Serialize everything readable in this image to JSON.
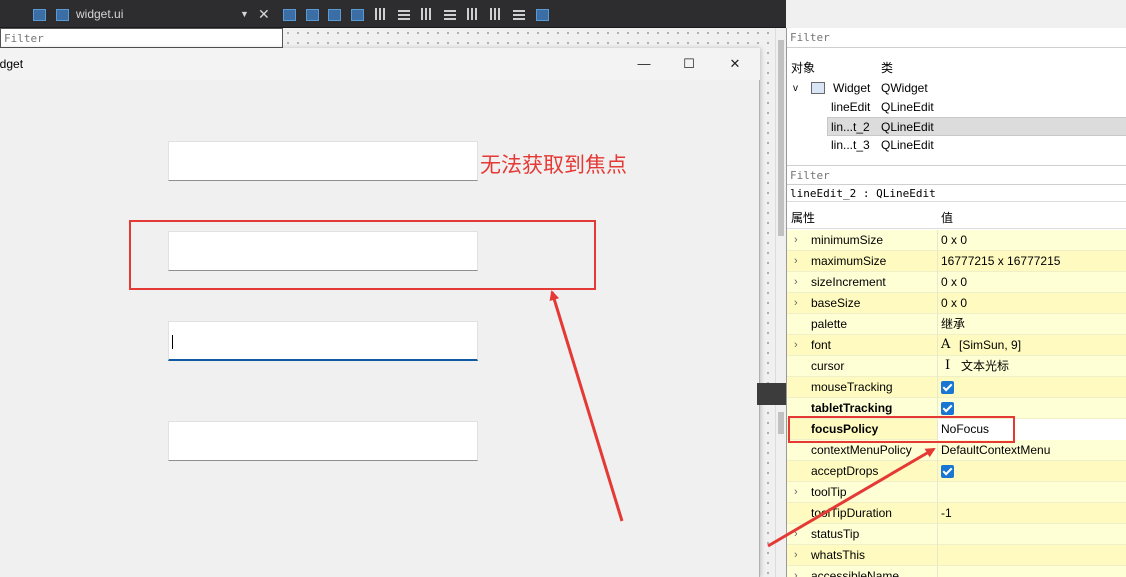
{
  "toolbar": {
    "file_name": "widget.ui"
  },
  "left_filter": {
    "placeholder": "Filter"
  },
  "preview": {
    "title": "idget",
    "minimize": "—",
    "maximize": "☐",
    "close": "✕",
    "annotation": "无法获取到焦点",
    "focused_text": "|"
  },
  "object_inspector": {
    "filter": "Filter",
    "col_object": "对象",
    "col_class": "类",
    "rows": [
      {
        "name": "Widget",
        "class": "QWidget"
      },
      {
        "name": "lineEdit",
        "class": "QLineEdit"
      },
      {
        "name": "lin...t_2",
        "class": "QLineEdit"
      },
      {
        "name": "lin...t_3",
        "class": "QLineEdit"
      }
    ]
  },
  "property_editor": {
    "filter": "Filter",
    "title": "lineEdit_2 : QLineEdit",
    "col_property": "属性",
    "col_value": "值",
    "rows": [
      {
        "name": "minimumSize",
        "value": "0 x 0"
      },
      {
        "name": "maximumSize",
        "value": "16777215 x 16777215"
      },
      {
        "name": "sizeIncrement",
        "value": "0 x 0"
      },
      {
        "name": "baseSize",
        "value": "0 x 0"
      },
      {
        "name": "palette",
        "value": "继承"
      },
      {
        "name": "font",
        "value": "[SimSun, 9]",
        "icon": "A"
      },
      {
        "name": "cursor",
        "value": "文本光标",
        "icon": "I"
      },
      {
        "name": "mouseTracking",
        "value": ""
      },
      {
        "name": "tabletTracking",
        "value": ""
      },
      {
        "name": "focusPolicy",
        "value": "NoFocus"
      },
      {
        "name": "contextMenuPolicy",
        "value": "DefaultContextMenu"
      },
      {
        "name": "acceptDrops",
        "value": ""
      },
      {
        "name": "toolTip",
        "value": ""
      },
      {
        "name": "toolTipDuration",
        "value": "-1"
      },
      {
        "name": "statusTip",
        "value": ""
      },
      {
        "name": "whatsThis",
        "value": ""
      },
      {
        "name": "accessibleName",
        "value": ""
      }
    ]
  },
  "colors": {
    "annotation": "#e53935",
    "focus_underline": "#0f5aa3",
    "property_bg": "#ffffd6",
    "checkbox": "#1976d2"
  }
}
